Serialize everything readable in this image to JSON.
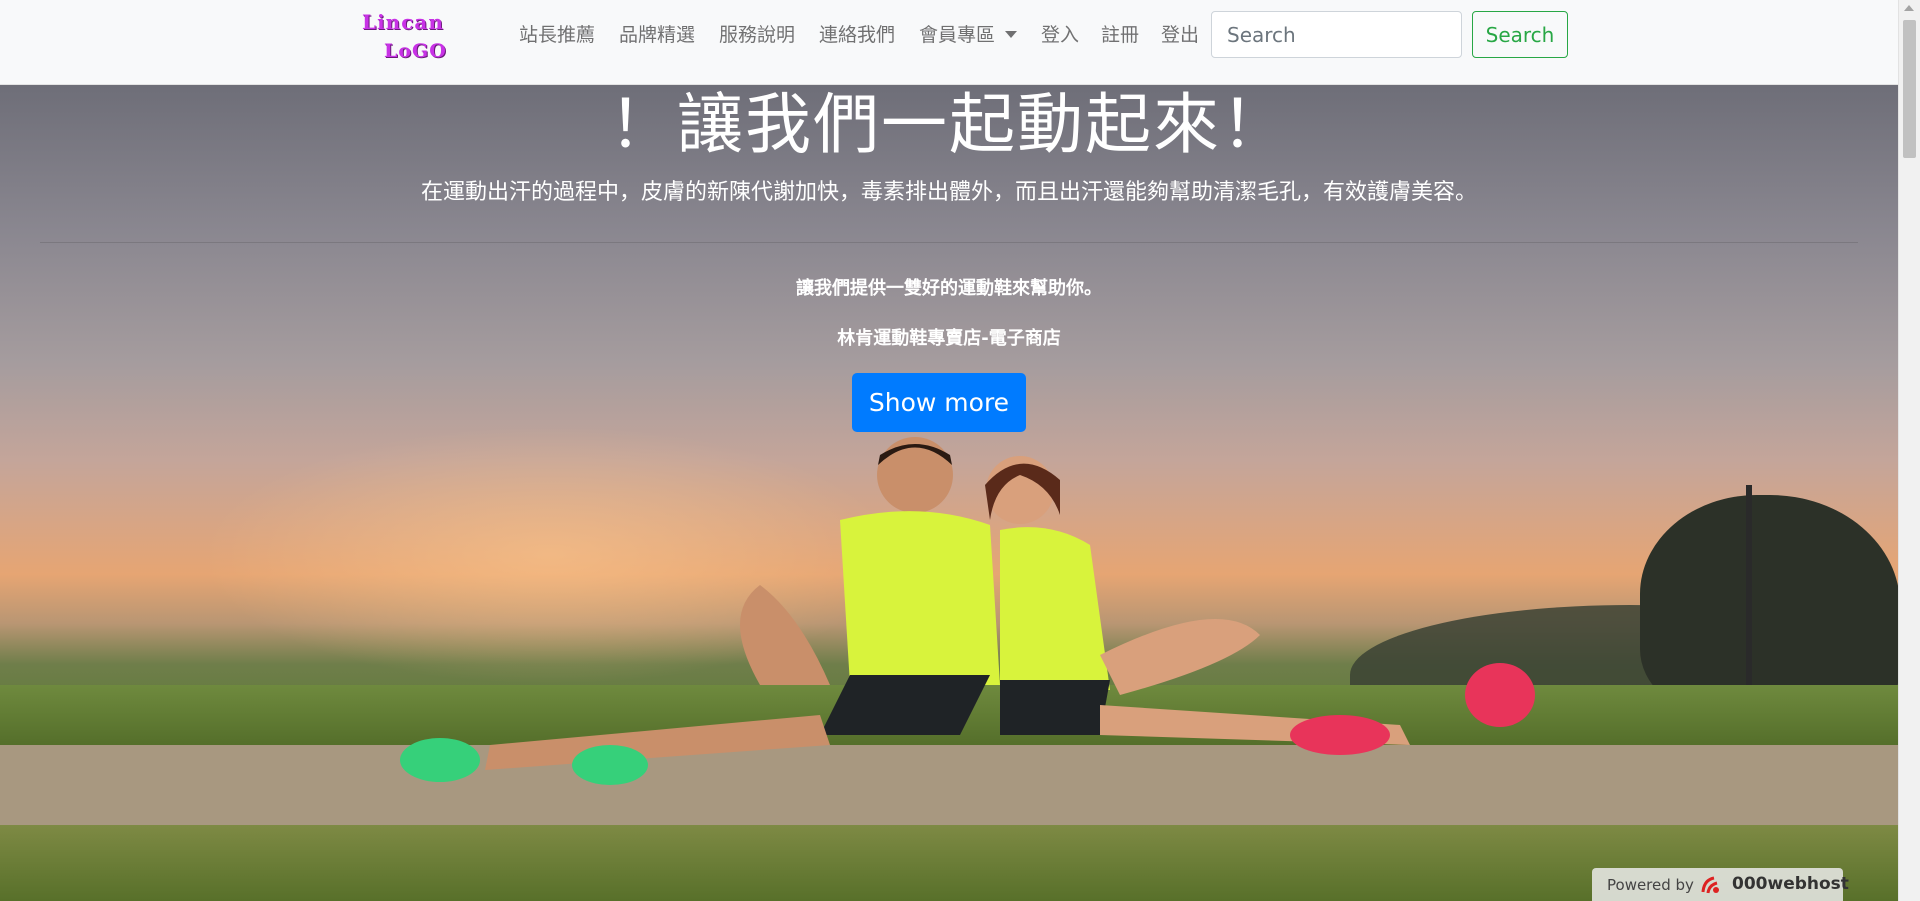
{
  "navbar": {
    "brand": {
      "line1": "Lincan",
      "line2": "LoGO"
    },
    "items": [
      {
        "label": "站長推薦"
      },
      {
        "label": "品牌精選"
      },
      {
        "label": "服務說明"
      },
      {
        "label": "連絡我們"
      },
      {
        "label": "會員專區"
      },
      {
        "label": "登入"
      },
      {
        "label": "註冊"
      },
      {
        "label": "登出"
      }
    ],
    "search": {
      "placeholder": "Search",
      "button_label": "Search"
    }
  },
  "hero": {
    "title": "！讓我們一起動起來！",
    "lead": "在運動出汗的過程中，皮膚的新陳代謝加快，毒素排出體外，而且出汗還能夠幫助清潔毛孔，有效護膚美容。",
    "line1": "讓我們提供一雙好的運動鞋來幫助你。",
    "line2": "林肯運動鞋專賣店-電子商店",
    "button_label": "Show more"
  },
  "footer_badge": {
    "powered_by": "Powered by",
    "host": "000webhost"
  },
  "colors": {
    "primary": "#007bff",
    "success": "#28a745",
    "brand": "#c832e6"
  }
}
